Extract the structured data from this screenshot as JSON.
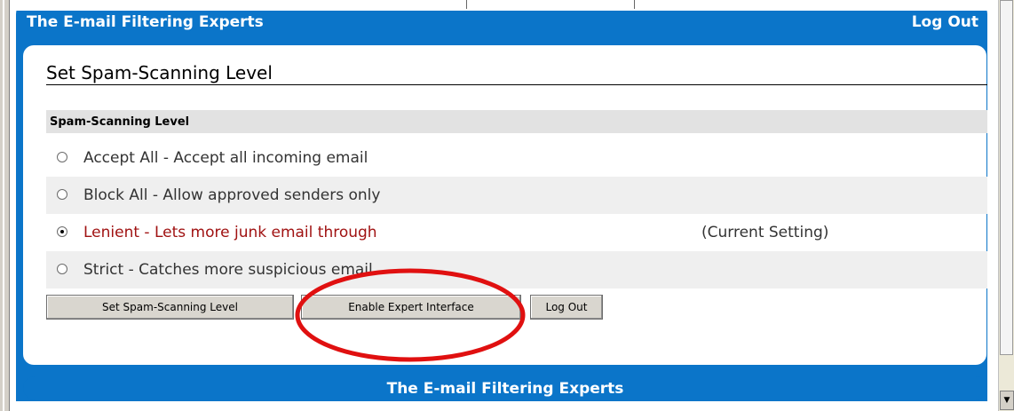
{
  "header": {
    "title": "The E-mail Filtering Experts",
    "logout_label": "Log Out"
  },
  "panel": {
    "title": "Set Spam-Scanning Level",
    "section_header": "Spam-Scanning Level",
    "options": [
      {
        "label": "Accept All - Accept all incoming email",
        "selected": false
      },
      {
        "label": "Block All - Allow approved senders only",
        "selected": false
      },
      {
        "label": "Lenient - Lets more junk email through",
        "selected": true,
        "note": "(Current Setting)"
      },
      {
        "label": "Strict - Catches more suspicious email",
        "selected": false
      }
    ],
    "buttons": {
      "set_level": "Set Spam-Scanning Level",
      "enable_expert": "Enable Expert Interface",
      "logout": "Log Out"
    }
  },
  "footer": {
    "title": "The E-mail Filtering Experts"
  },
  "colors": {
    "brand_blue": "#0b75c9",
    "selected_text": "#a01212",
    "annotation_red": "#e01010"
  },
  "annotation": {
    "shape": "ellipse",
    "highlights": "enable-expert-interface-button"
  }
}
